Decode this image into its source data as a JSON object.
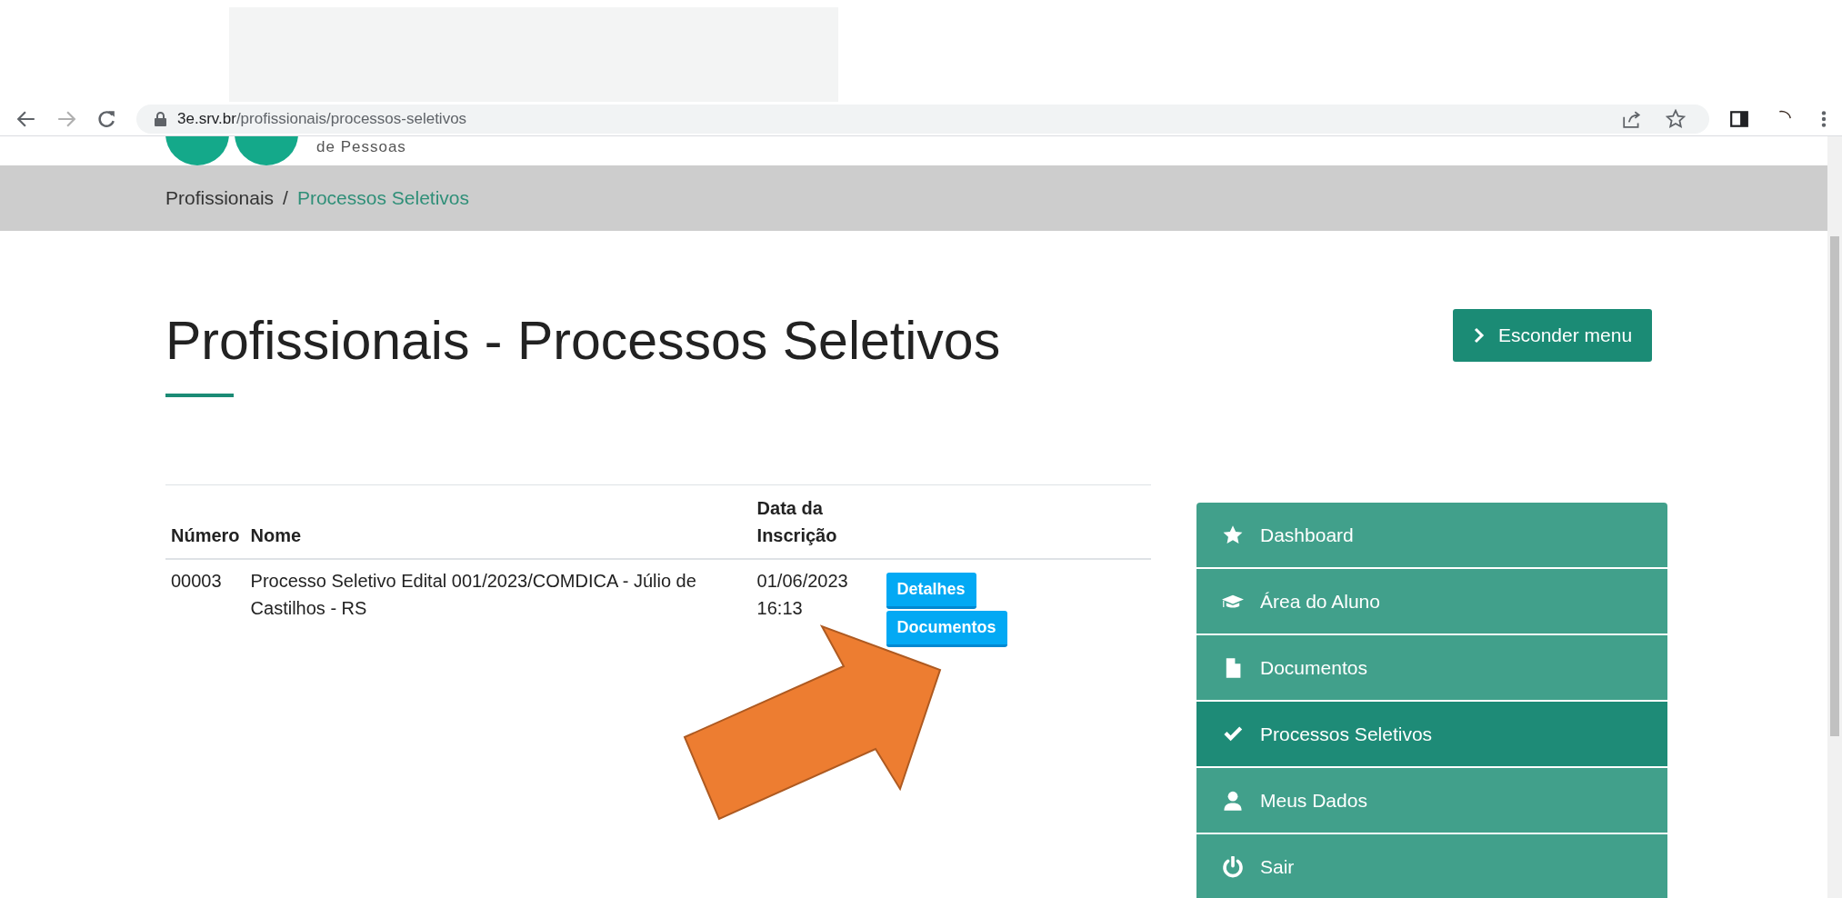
{
  "browser": {
    "url_host": "3e.srv.br",
    "url_path": "/profissionais/processos-seletivos",
    "forward_disabled": true
  },
  "logo": {
    "tagline": "de Pessoas"
  },
  "breadcrumb_separator": "/",
  "breadcrumb": [
    {
      "label": "Profissionais",
      "selected": false
    },
    {
      "label": "Processos Seletivos",
      "selected": true
    }
  ],
  "page_title": "Profissionais - Processos Seletivos",
  "toggle_button": {
    "label": "Esconder menu"
  },
  "table": {
    "columns": [
      "Número",
      "Nome",
      "Data da Inscrição"
    ],
    "rows": [
      {
        "cells": [
          "00003",
          "Processo Seletivo Edital 001/2023/COMDICA - Júlio de Castilhos - RS",
          "01/06/2023 16:13"
        ],
        "actions": [
          "Detalhes",
          "Documentos"
        ]
      }
    ]
  },
  "sidebar": {
    "items": [
      {
        "label": "Dashboard",
        "kind": "star",
        "selected": false
      },
      {
        "label": "Área do Aluno",
        "kind": "cap",
        "selected": false
      },
      {
        "label": "Documentos",
        "kind": "file",
        "selected": false
      },
      {
        "label": "Processos Seletivos",
        "kind": "check",
        "selected": true
      },
      {
        "label": "Meus Dados",
        "kind": "user",
        "selected": false
      },
      {
        "label": "Sair",
        "kind": "power",
        "selected": false
      }
    ]
  }
}
